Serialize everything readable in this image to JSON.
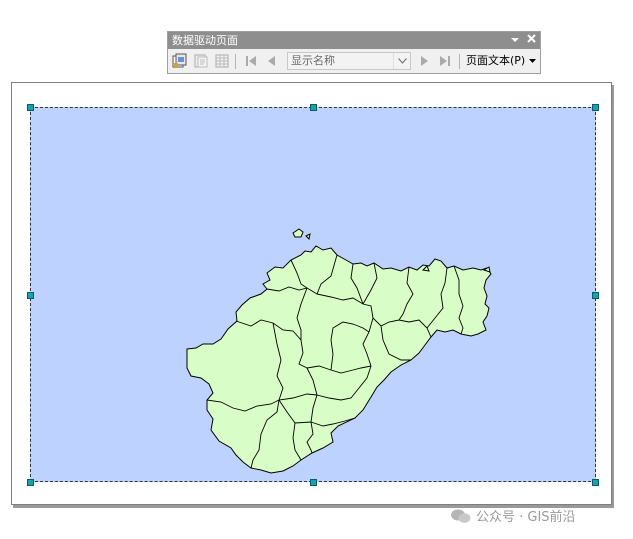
{
  "toolbar": {
    "title": "数据驱动页面",
    "dropdown_icon": "chevron-down-icon",
    "close_icon": "close-icon",
    "combo_value": "显示名称",
    "page_text_label": "页面文本(P)"
  },
  "map": {
    "water_color": "#bed2ff",
    "land_color": "#d9fdc6",
    "boundary_color": "#000000"
  },
  "watermark": {
    "text": "公众号 · GIS前沿"
  }
}
